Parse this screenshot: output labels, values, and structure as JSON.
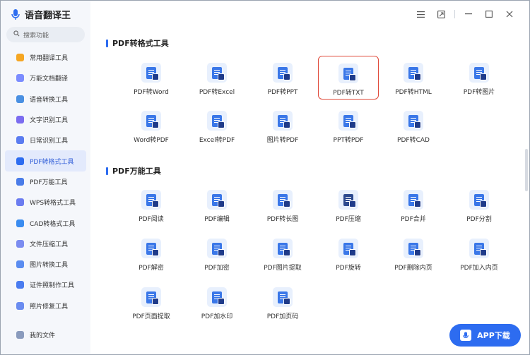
{
  "app": {
    "title": "语音翻译王"
  },
  "search": {
    "placeholder": "搜索功能"
  },
  "sidebar": {
    "items": [
      {
        "label": "常用翻译工具",
        "color": "#f5a623",
        "active": false
      },
      {
        "label": "万能文档翻译",
        "color": "#7b8cff",
        "active": false
      },
      {
        "label": "语音转换工具",
        "color": "#4a90e2",
        "active": false
      },
      {
        "label": "文字识别工具",
        "color": "#7b6cf0",
        "active": false
      },
      {
        "label": "日常识别工具",
        "color": "#5b7cf0",
        "active": false
      },
      {
        "label": "PDF转格式工具",
        "color": "#2d6cf0",
        "active": true
      },
      {
        "label": "PDF万能工具",
        "color": "#4a7ce8",
        "active": false
      },
      {
        "label": "WPS转格式工具",
        "color": "#6b7cf0",
        "active": false
      },
      {
        "label": "CAD转格式工具",
        "color": "#3a8cf0",
        "active": false
      },
      {
        "label": "文件压缩工具",
        "color": "#7b8cf0",
        "active": false
      },
      {
        "label": "图片转换工具",
        "color": "#5a8cf0",
        "active": false
      },
      {
        "label": "证件照制作工具",
        "color": "#4a7cf0",
        "active": false
      },
      {
        "label": "照片修复工具",
        "color": "#6a8cf0",
        "active": false
      }
    ],
    "bottom": "我的文件"
  },
  "sections": [
    {
      "title": "PDF转格式工具",
      "tools": [
        "PDF转Word",
        "PDF转Excel",
        "PDF转PPT",
        "PDF转TXT",
        "PDF转HTML",
        "PDF转图片",
        "Word转PDF",
        "Excel转PDF",
        "图片转PDF",
        "PPT转PDF",
        "PDF转CAD"
      ],
      "selected": "PDF转TXT"
    },
    {
      "title": "PDF万能工具",
      "tools": [
        "PDF阅读",
        "PDF编辑",
        "PDF转长图",
        "PDF压缩",
        "PDF合并",
        "PDF分割",
        "PDF解密",
        "PDF加密",
        "PDF图片提取",
        "PDF旋转",
        "PDF删除内页",
        "PDF加入内页",
        "PDF页面提取",
        "PDF加水印",
        "PDF加页码"
      ]
    }
  ],
  "app_download": {
    "label": "APP下载"
  },
  "colors": {
    "accent": "#2d6cf0",
    "selected_border": "#e04a3a"
  }
}
